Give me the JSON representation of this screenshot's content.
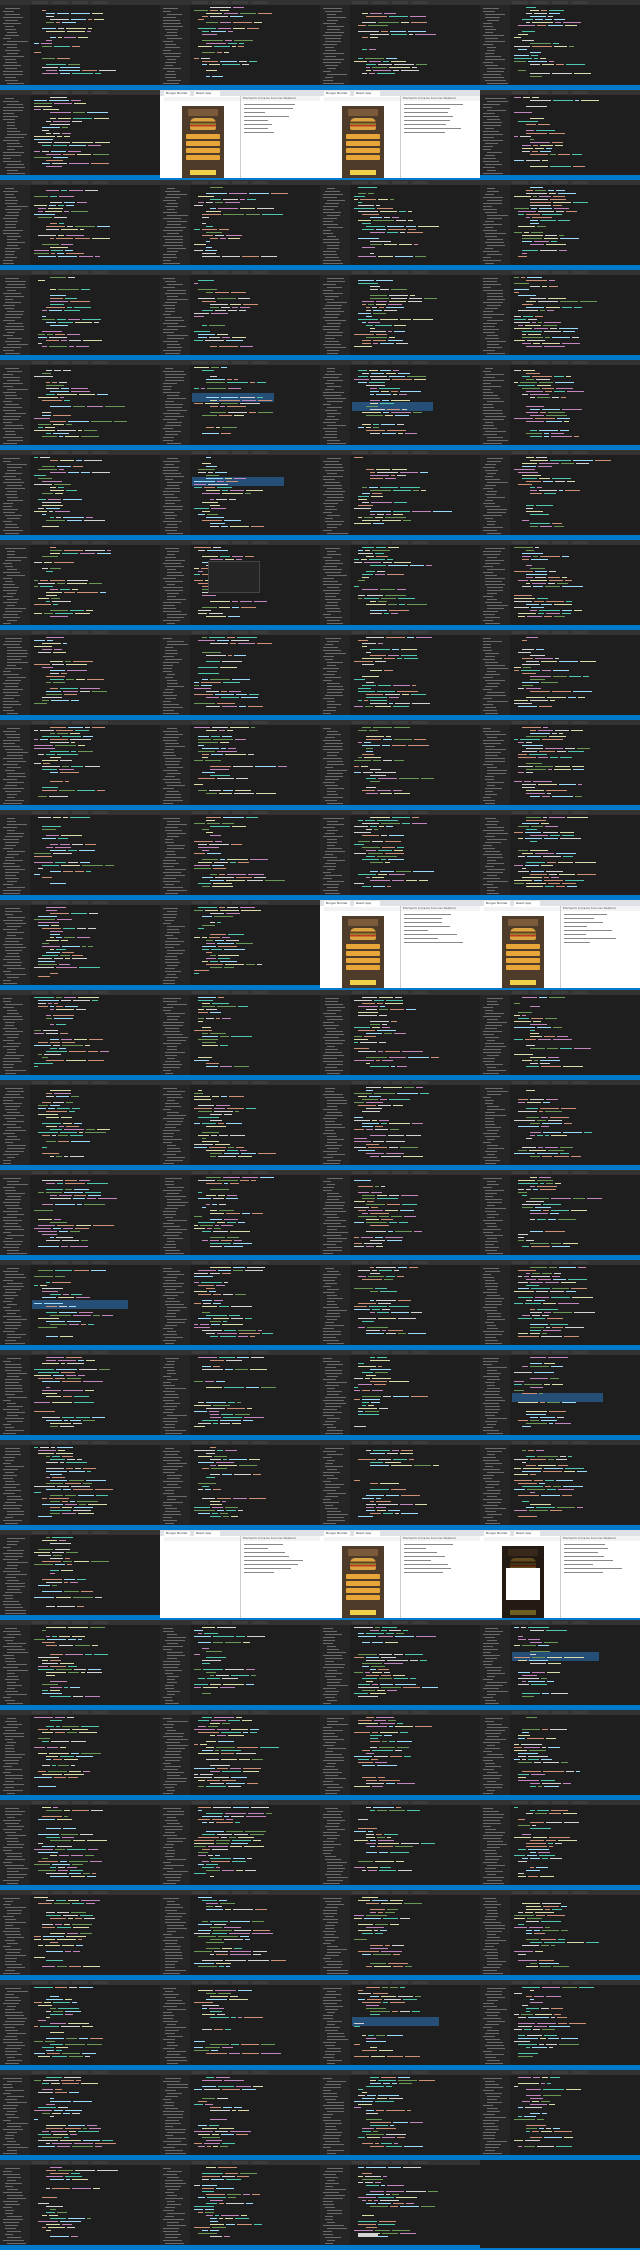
{
  "grid": {
    "columns": 4,
    "rows": 25
  },
  "editor": {
    "theme_colors": {
      "background": "#1e1e1e",
      "sidebar": "#252526",
      "titlebar": "#323233",
      "status_bar": "#007acc",
      "selection": "#264f78",
      "keyword": "#c586c0",
      "function": "#dcdcaa",
      "string": "#ce9178",
      "variable": "#9cdcfe",
      "type": "#4ec9b0",
      "plain": "#d4d4d4",
      "comment": "#6a9955"
    }
  },
  "browser": {
    "tab_label": "Burger Builder",
    "tab_label_2": "React App",
    "devtools_tabs": [
      "Elements",
      "Console",
      "Sources",
      "Network"
    ],
    "colors": {
      "app_background": "#4e3b2a",
      "bun": "#d9a441",
      "meat": "#6b3d1f",
      "salad": "#7fb842",
      "order_button": "#f0d24a"
    }
  },
  "tiles": [
    "editor",
    "editor",
    "editor",
    "editor",
    "editor",
    "browser-devtools",
    "browser-devtools",
    "editor",
    "editor",
    "editor",
    "editor",
    "editor",
    "editor",
    "editor",
    "editor",
    "editor",
    "editor",
    "editor-sel",
    "editor-sel",
    "editor",
    "editor",
    "editor-sel",
    "editor",
    "editor",
    "editor",
    "editor-menu",
    "editor",
    "editor",
    "editor",
    "editor",
    "editor",
    "editor",
    "editor",
    "editor",
    "editor",
    "editor",
    "editor",
    "editor",
    "editor",
    "editor",
    "editor",
    "editor",
    "browser-devtools",
    "browser-devtools",
    "editor",
    "editor",
    "editor",
    "editor",
    "editor",
    "editor",
    "editor",
    "editor",
    "editor",
    "editor",
    "editor",
    "editor",
    "editor-sel",
    "editor",
    "editor",
    "editor",
    "editor",
    "editor",
    "editor",
    "editor-sel",
    "editor",
    "editor",
    "editor",
    "editor",
    "editor",
    "browser-blank",
    "browser-devtools",
    "browser-modal",
    "editor",
    "editor",
    "editor",
    "editor-sel",
    "editor",
    "editor",
    "editor",
    "editor",
    "editor",
    "editor",
    "editor",
    "editor",
    "editor",
    "editor",
    "editor",
    "editor",
    "editor",
    "editor",
    "editor-sel",
    "editor",
    "editor",
    "editor",
    "editor",
    "editor",
    "editor",
    "editor",
    "editor-cursor",
    "blank"
  ]
}
